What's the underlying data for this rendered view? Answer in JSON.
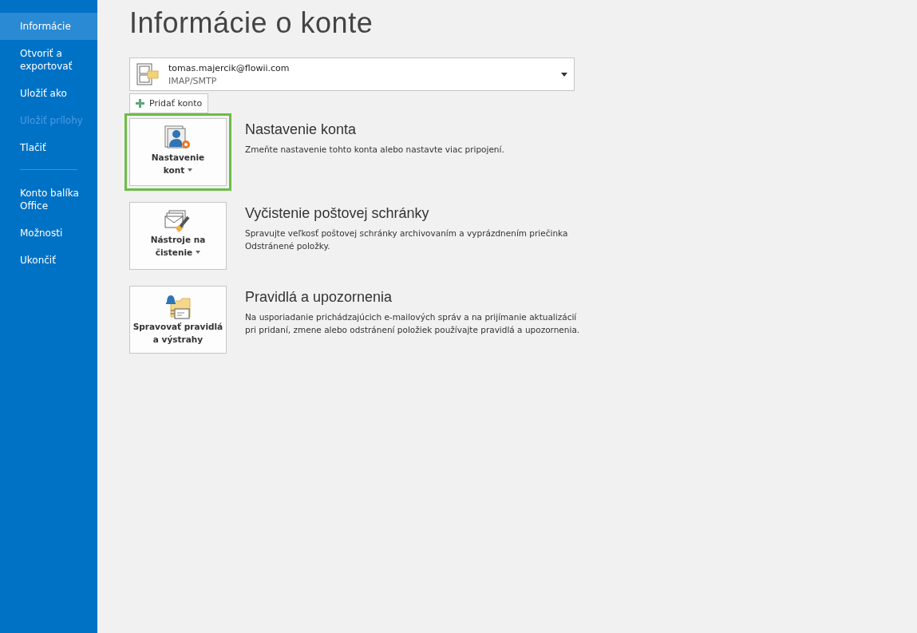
{
  "sidebar": {
    "items": [
      {
        "kind": "item",
        "label": "Informácie",
        "selected": true,
        "disabled": false
      },
      {
        "kind": "item",
        "label": "Otvoriť a exportovať",
        "selected": false,
        "disabled": false
      },
      {
        "kind": "item",
        "label": "Uložiť ako",
        "selected": false,
        "disabled": false
      },
      {
        "kind": "item",
        "label": "Uložiť prílohy",
        "selected": false,
        "disabled": true
      },
      {
        "kind": "item",
        "label": "Tlačiť",
        "selected": false,
        "disabled": false
      },
      {
        "kind": "divider"
      },
      {
        "kind": "item",
        "label": "Konto balíka Office",
        "selected": false,
        "disabled": false
      },
      {
        "kind": "item",
        "label": "Možnosti",
        "selected": false,
        "disabled": false
      },
      {
        "kind": "item",
        "label": "Ukončiť",
        "selected": false,
        "disabled": false
      }
    ]
  },
  "title": "Informácie o konte",
  "account": {
    "email": "tomas.majercik@flowii.com",
    "type": "IMAP/SMTP"
  },
  "add_account": "Pridať konto",
  "sections": [
    {
      "kind": "account-settings",
      "button_lines": [
        "Nastavenie",
        "kont"
      ],
      "dropdown": true,
      "highlighted": true,
      "heading": "Nastavenie konta",
      "description": "Zmeňte nastavenie tohto konta alebo nastavte viac pripojení."
    },
    {
      "kind": "cleanup",
      "button_lines": [
        "Nástroje na",
        "čistenie"
      ],
      "dropdown": true,
      "highlighted": false,
      "heading": "Vyčistenie poštovej schránky",
      "description": "Spravujte veľkosť poštovej schránky archivovaním a vyprázdnením priečinka Odstránené položky."
    },
    {
      "kind": "rules",
      "button_lines": [
        "Spravovať pravidlá",
        "a výstrahy"
      ],
      "dropdown": false,
      "highlighted": false,
      "heading": "Pravidlá a upozornenia",
      "description": "Na usporiadanie prichádzajúcich e-mailových správ a na prijímanie aktualizácií pri pridaní, zmene alebo odstránení položiek používajte pravidlá a upozornenia."
    }
  ]
}
